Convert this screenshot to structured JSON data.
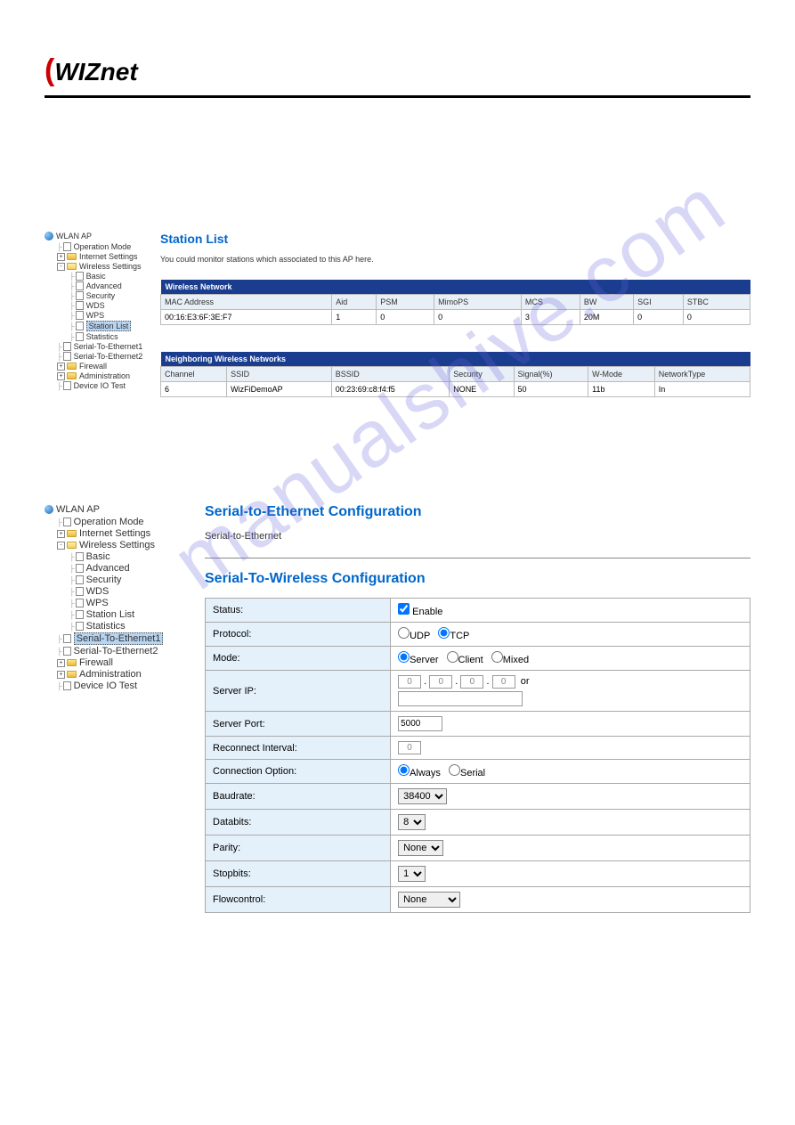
{
  "logo": {
    "text": "WIZnet"
  },
  "watermark": "manualshive.com",
  "section1": {
    "tree": {
      "root": "WLAN AP",
      "items": [
        {
          "label": "Operation Mode",
          "type": "page",
          "indent": 1
        },
        {
          "label": "Internet Settings",
          "type": "folder",
          "expand": "+",
          "indent": 1
        },
        {
          "label": "Wireless Settings",
          "type": "folder-open",
          "expand": "-",
          "indent": 1
        },
        {
          "label": "Basic",
          "type": "page",
          "indent": 2
        },
        {
          "label": "Advanced",
          "type": "page",
          "indent": 2
        },
        {
          "label": "Security",
          "type": "page",
          "indent": 2
        },
        {
          "label": "WDS",
          "type": "page",
          "indent": 2
        },
        {
          "label": "WPS",
          "type": "page",
          "indent": 2
        },
        {
          "label": "Station List",
          "type": "page",
          "indent": 2,
          "selected": true
        },
        {
          "label": "Statistics",
          "type": "page",
          "indent": 2
        },
        {
          "label": "Serial-To-Ethernet1",
          "type": "page",
          "indent": 1
        },
        {
          "label": "Serial-To-Ethernet2",
          "type": "page",
          "indent": 1
        },
        {
          "label": "Firewall",
          "type": "folder",
          "expand": "+",
          "indent": 1
        },
        {
          "label": "Administration",
          "type": "folder",
          "expand": "+",
          "indent": 1
        },
        {
          "label": "Device IO Test",
          "type": "page",
          "indent": 1
        }
      ]
    },
    "title": "Station List",
    "subtitle": "You could monitor stations which associated to this AP here.",
    "wireless_table": {
      "header": "Wireless Network",
      "cols": [
        "MAC Address",
        "Aid",
        "PSM",
        "MimoPS",
        "MCS",
        "BW",
        "SGI",
        "STBC"
      ],
      "rows": [
        [
          "00:16:E3:6F:3E:F7",
          "1",
          "0",
          "0",
          "3",
          "20M",
          "0",
          "0"
        ]
      ]
    },
    "neighbor_table": {
      "header": "Neighboring Wireless Networks",
      "cols": [
        "Channel",
        "SSID",
        "BSSID",
        "Security",
        "Signal(%)",
        "W-Mode",
        "NetworkType"
      ],
      "rows": [
        [
          "6",
          "WizFiDemoAP",
          "00:23:69:c8:f4:f5",
          "NONE",
          "50",
          "11b",
          "In"
        ]
      ]
    }
  },
  "section2": {
    "tree": {
      "root": "WLAN AP",
      "items": [
        {
          "label": "Operation Mode",
          "type": "page",
          "indent": 1
        },
        {
          "label": "Internet Settings",
          "type": "folder",
          "expand": "+",
          "indent": 1
        },
        {
          "label": "Wireless Settings",
          "type": "folder-open",
          "expand": "-",
          "indent": 1
        },
        {
          "label": "Basic",
          "type": "page",
          "indent": 2
        },
        {
          "label": "Advanced",
          "type": "page",
          "indent": 2
        },
        {
          "label": "Security",
          "type": "page",
          "indent": 2
        },
        {
          "label": "WDS",
          "type": "page",
          "indent": 2
        },
        {
          "label": "WPS",
          "type": "page",
          "indent": 2
        },
        {
          "label": "Station List",
          "type": "page",
          "indent": 2
        },
        {
          "label": "Statistics",
          "type": "page",
          "indent": 2
        },
        {
          "label": "Serial-To-Ethernet1",
          "type": "page",
          "indent": 1,
          "selected": true
        },
        {
          "label": "Serial-To-Ethernet2",
          "type": "page",
          "indent": 1
        },
        {
          "label": "Firewall",
          "type": "folder",
          "expand": "+",
          "indent": 1
        },
        {
          "label": "Administration",
          "type": "folder",
          "expand": "+",
          "indent": 1
        },
        {
          "label": "Device IO Test",
          "type": "page",
          "indent": 1
        }
      ]
    },
    "title1": "Serial-to-Ethernet Configuration",
    "subtitle1": "Serial-to-Ethernet",
    "title2": "Serial-To-Wireless Configuration",
    "form": {
      "status": {
        "label": "Status:",
        "checkbox": "Enable",
        "checked": true
      },
      "protocol": {
        "label": "Protocol:",
        "options": [
          "UDP",
          "TCP"
        ],
        "selected": "TCP"
      },
      "mode": {
        "label": "Mode:",
        "options": [
          "Server",
          "Client",
          "Mixed"
        ],
        "selected": "Server"
      },
      "server_ip": {
        "label": "Server IP:",
        "octets": [
          "0",
          "0",
          "0",
          "0"
        ],
        "suffix": "or",
        "extra": ""
      },
      "server_port": {
        "label": "Server Port:",
        "value": "5000"
      },
      "reconnect": {
        "label": "Reconnect Interval:",
        "value": "0"
      },
      "connection": {
        "label": "Connection Option:",
        "options": [
          "Always",
          "Serial"
        ],
        "selected": "Always"
      },
      "baudrate": {
        "label": "Baudrate:",
        "value": "38400"
      },
      "databits": {
        "label": "Databits:",
        "value": "8"
      },
      "parity": {
        "label": "Parity:",
        "value": "None"
      },
      "stopbits": {
        "label": "Stopbits:",
        "value": "1"
      },
      "flowcontrol": {
        "label": "Flowcontrol:",
        "value": "None"
      }
    }
  }
}
